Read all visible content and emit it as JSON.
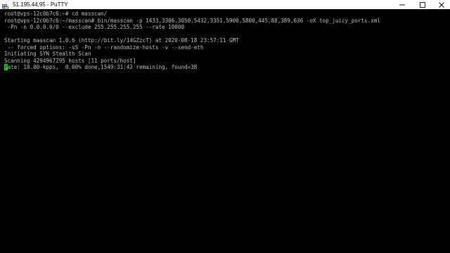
{
  "window": {
    "title": "51.195.44.95 - PuTTY"
  },
  "colors": {
    "terminal_bg": "#000000",
    "terminal_fg": "#c0c0c0",
    "cursor": "#00d000",
    "titlebar_bg": "#ffffff"
  },
  "icons": {
    "app": "putty-app-icon",
    "minimize": "minimize-icon",
    "maximize": "maximize-icon",
    "close": "close-icon"
  },
  "terminal": {
    "lines": [
      "root@vps-12c0b7c6:~# cd masscan/",
      "root@vps-12c0b7c6:~/masscan# bin/masscan -p 1433,3306,3050,5432,3351,5900,5800,445,88,389,636 -oX top_juicy_ports.xml",
      " -Pn -n 0.0.0.0/0 --exclude 255.255.255.255 --rate 10000",
      "",
      "Starting masscan 1.0.6 (http://bit.ly/14GZzcT) at 2020-08-18 23:57:11 GMT",
      " -- forced options: -sS -Pn -n --randomize-hosts -v --send-eth",
      "Initiating SYN Stealth Scan",
      "Scanning 4294967295 hosts [11 ports/host]"
    ],
    "status_cursor_char": "r",
    "status_rest": "ate: 10.00-kpps,  0.00% done,1549:31:42 remaining, found=38"
  }
}
